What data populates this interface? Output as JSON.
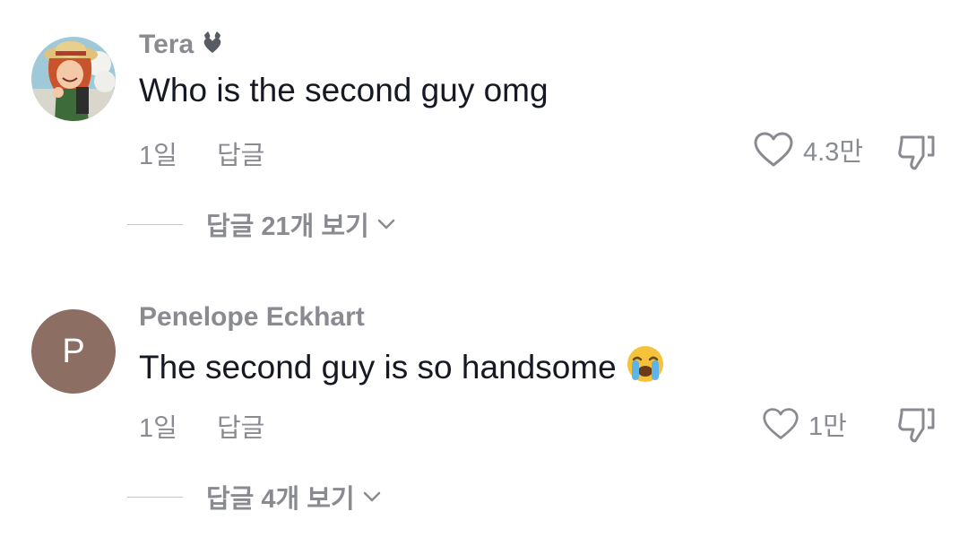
{
  "comments": [
    {
      "username": "Tera",
      "badge_icon": "heart-ribbon-icon",
      "text": "Who is the second guy omg",
      "time": "1일",
      "reply_label": "답글",
      "likes": "4.3만",
      "view_replies": "답글 21개 보기",
      "avatar": "profile-photo"
    },
    {
      "username": "Penelope Eckhart",
      "text": "The second guy is so handsome",
      "emoji": "loudly-crying-face-emoji",
      "time": "1일",
      "reply_label": "답글",
      "likes": "1만",
      "view_replies": "답글 4개 보기",
      "avatar_letter": "P",
      "avatar_color": "#8d6e63"
    }
  ],
  "colors": {
    "primary_text": "#161823",
    "secondary_text": "#8a8b91",
    "divider": "#c5c6ca"
  }
}
